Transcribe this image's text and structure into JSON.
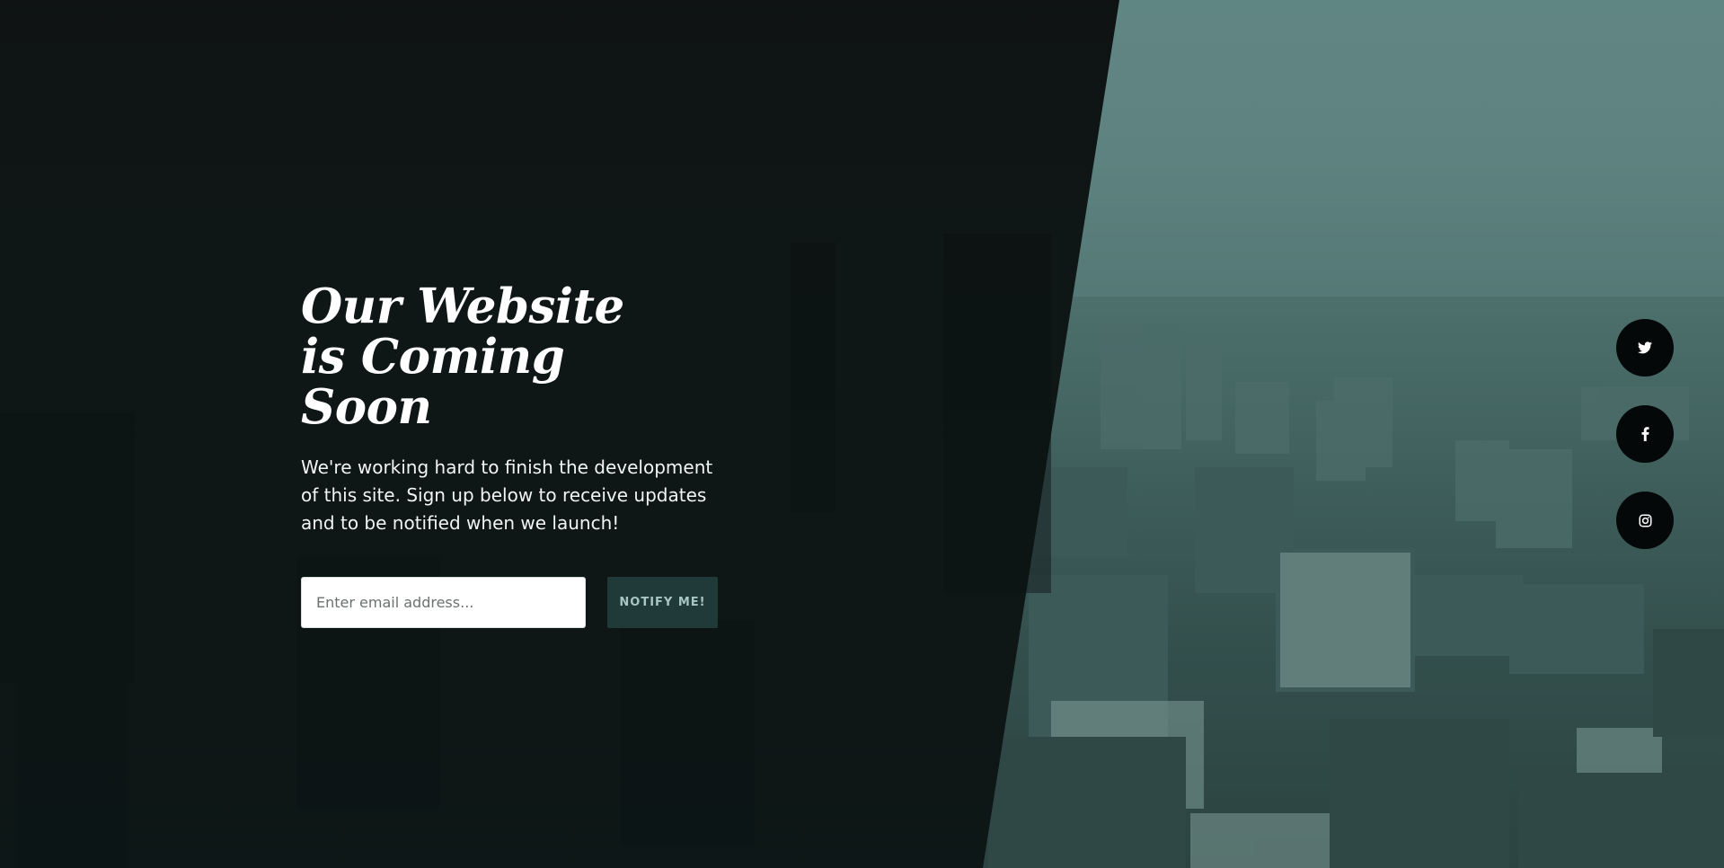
{
  "hero": {
    "headline": "Our Website is Coming Soon",
    "description": "We're working hard to finish the development of this site. Sign up below to receive updates and to be notified when we launch!"
  },
  "signup": {
    "email_placeholder": "Enter email address...",
    "email_value": "",
    "button_label": "NOTIFY ME!"
  },
  "social": [
    {
      "icon": "twitter-icon"
    },
    {
      "icon": "facebook-icon"
    },
    {
      "icon": "instagram-icon"
    }
  ],
  "colors": {
    "accent": "#1f3a38",
    "button_text": "#a9c6c2",
    "overlay": "#0b0f0f",
    "social_bg": "#050808"
  }
}
